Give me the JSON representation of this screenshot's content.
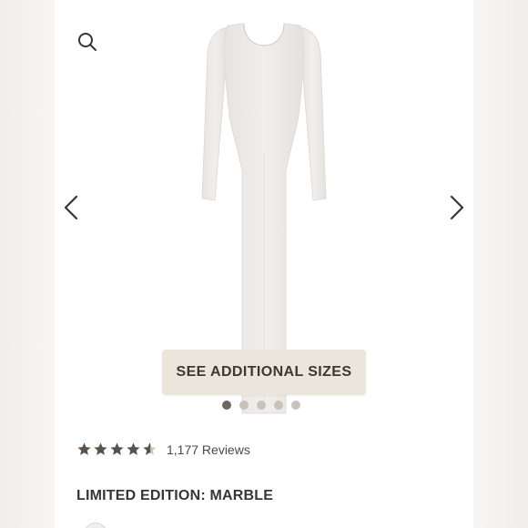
{
  "product": {
    "sizes_button_label": "SEE ADDITIONAL SIZES",
    "review_count_text": "1,177 Reviews",
    "rating": 4.5,
    "rating_max": 5,
    "edition_label": "LIMITED EDITION: MARBLE"
  },
  "carousel": {
    "slide_count": 5,
    "active_index": 0
  },
  "icons": {
    "search": "search-icon",
    "prev": "chevron-left-icon",
    "next": "chevron-right-icon",
    "star": "star-icon"
  },
  "colors": {
    "button_bg": "#ebe5dc",
    "text_dark": "#3a3530",
    "dot_active": "#6e6660",
    "dot_inactive": "#c9c2bb",
    "star": "#5a524b"
  }
}
